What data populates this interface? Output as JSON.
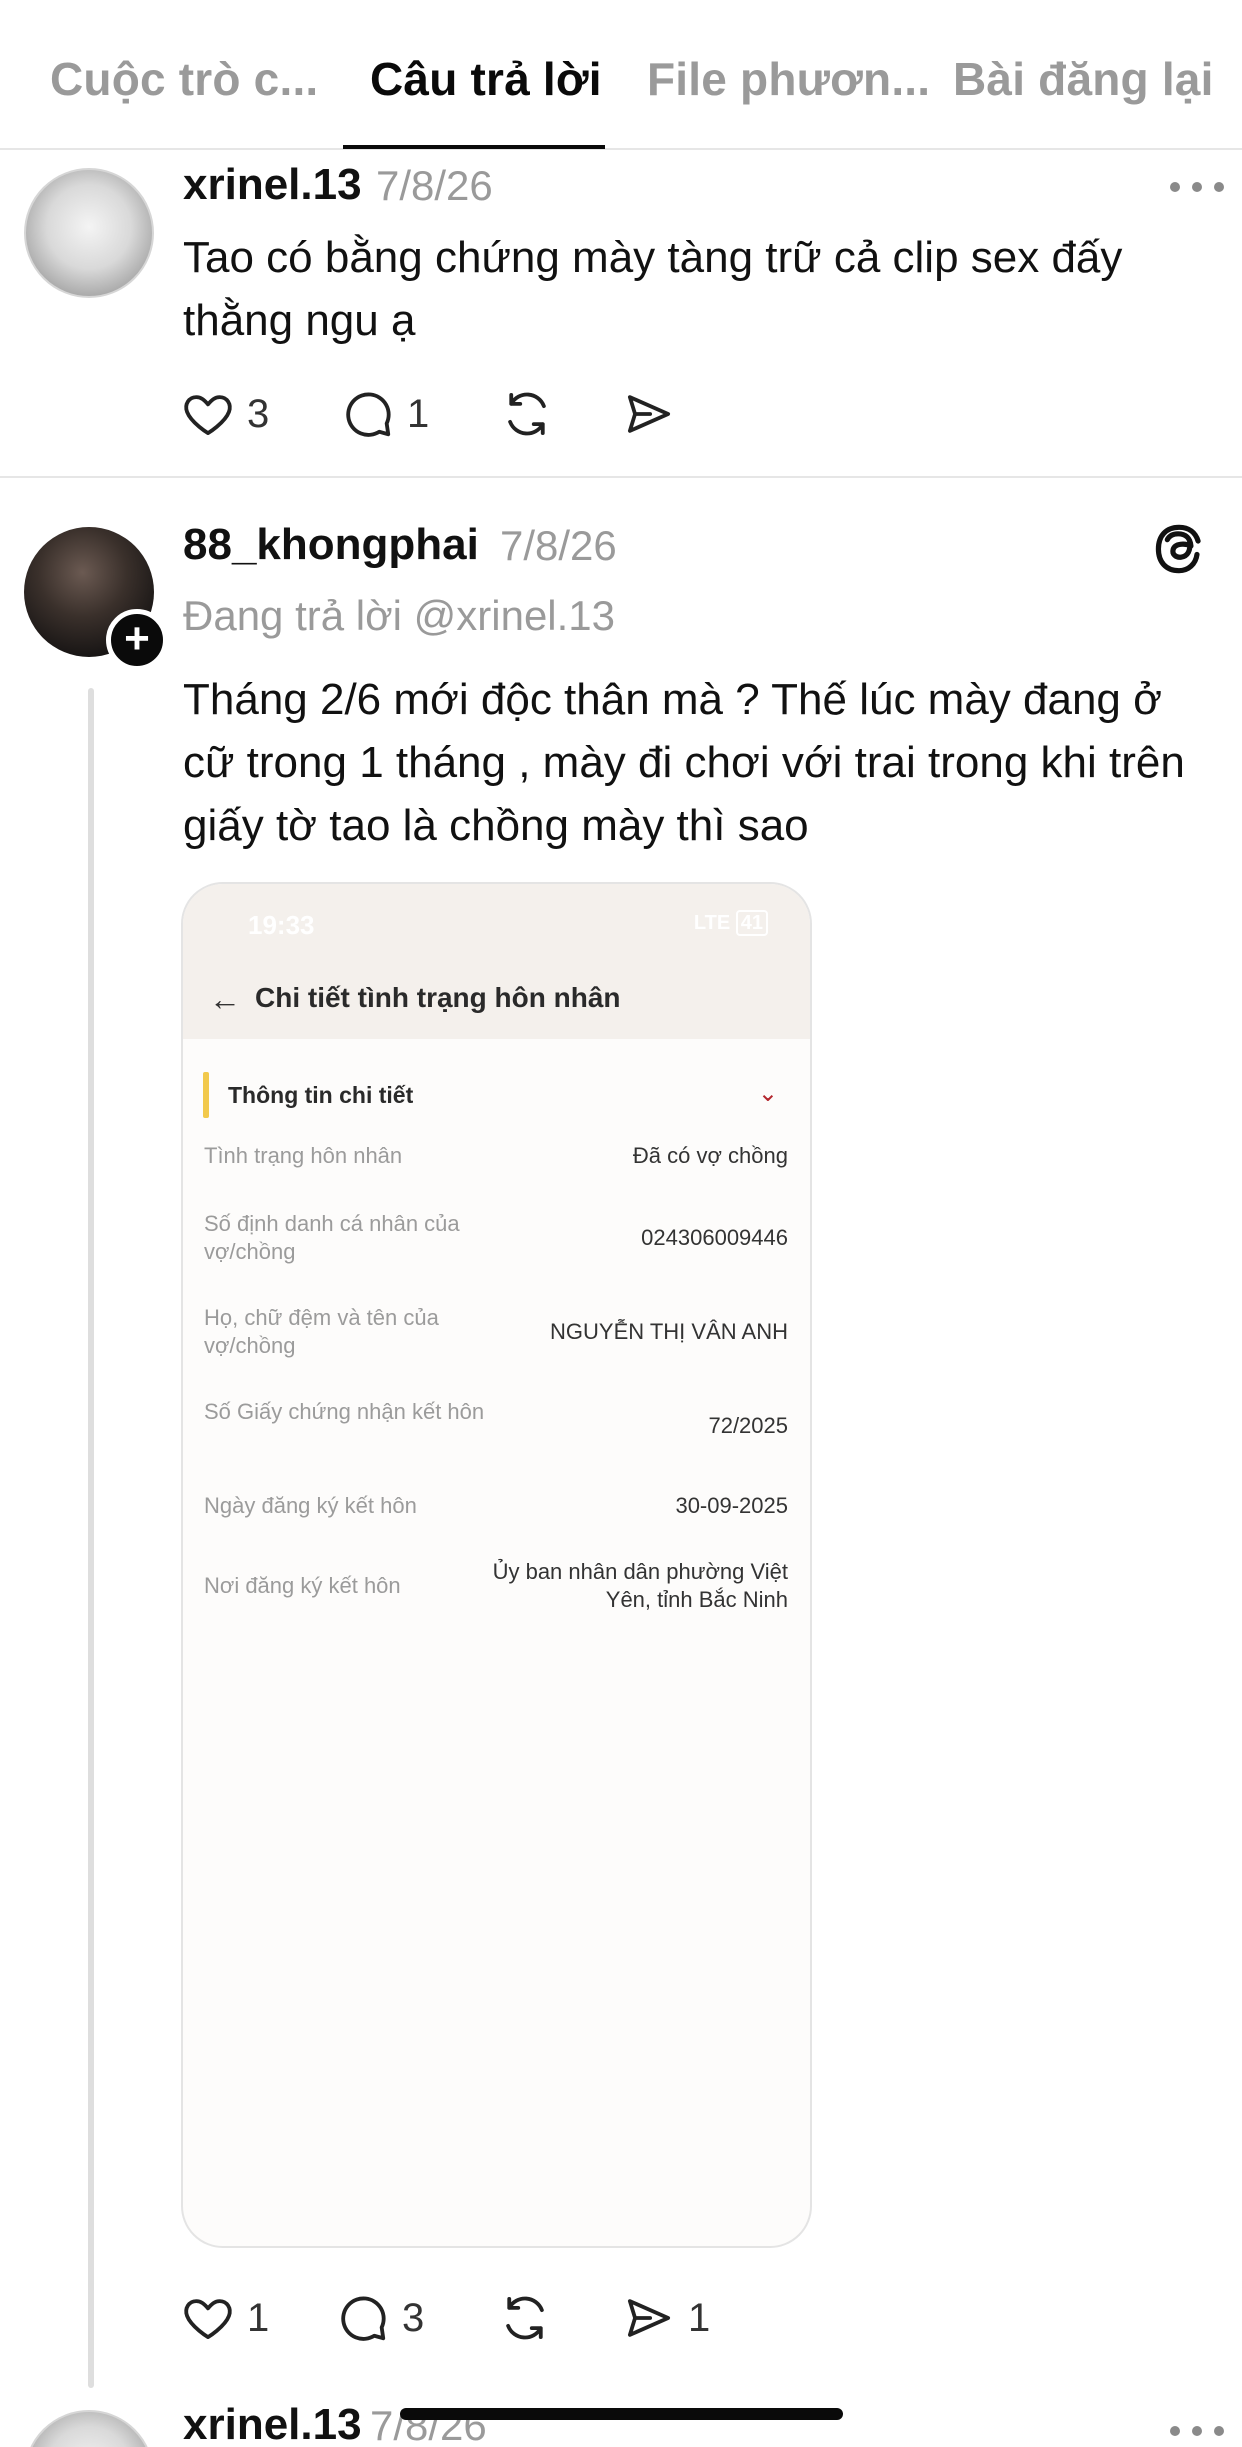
{
  "tabs": [
    {
      "label": "Cuộc trò c..."
    },
    {
      "label": "Câu trả lời"
    },
    {
      "label": "File phươn..."
    },
    {
      "label": "Bài đăng lại"
    }
  ],
  "posts": [
    {
      "username": "xrinel.13",
      "date": "7/8/26",
      "text": "Tao có bằng chứng mày tàng trữ cả clip sex đấy thằng ngu ạ",
      "likes": "3",
      "comments": "1",
      "reposts": "",
      "shares": ""
    },
    {
      "username": "88_khongphai",
      "date": "7/8/26",
      "reply_to": "Đang trả lời @xrinel.13",
      "text": "Tháng 2/6 mới độc thân mà ? Thế lúc mày đang ở cữ trong 1 tháng , mày đi chơi với trai trong khi trên giấy tờ tao là chồng mày thì sao",
      "likes": "1",
      "comments": "3",
      "reposts": "",
      "shares": "1"
    },
    {
      "username": "xrinel.13",
      "date": "7/8/26"
    }
  ],
  "screenshot": {
    "status_time": "19:33",
    "status_network": "LTE",
    "status_battery": "41",
    "title": "Chi tiết tình trạng hôn nhân",
    "section_title": "Thông tin chi tiết",
    "rows": [
      {
        "label": "Tình trạng hôn nhân",
        "value": "Đã có vợ chồng"
      },
      {
        "label": "Số định danh cá nhân của vợ/chồng",
        "value": "024306009446"
      },
      {
        "label": "Họ, chữ đệm và tên của vợ/chồng",
        "value": "NGUYỄN THỊ VÂN ANH"
      },
      {
        "label": "Số Giấy chứng nhận kết hôn",
        "value": "72/2025"
      },
      {
        "label": "Ngày đăng ký kết hôn",
        "value": "30-09-2025"
      },
      {
        "label": "Nơi đăng ký kết hôn",
        "value": "Ủy ban nhân dân phường Việt Yên, tỉnh Bắc Ninh"
      }
    ]
  },
  "icons": {
    "like": "heart-icon",
    "comment": "comment-icon",
    "repost": "repost-icon",
    "share": "share-icon",
    "more": "more-dots-icon",
    "threads": "threads-logo-icon",
    "follow": "plus-icon"
  }
}
